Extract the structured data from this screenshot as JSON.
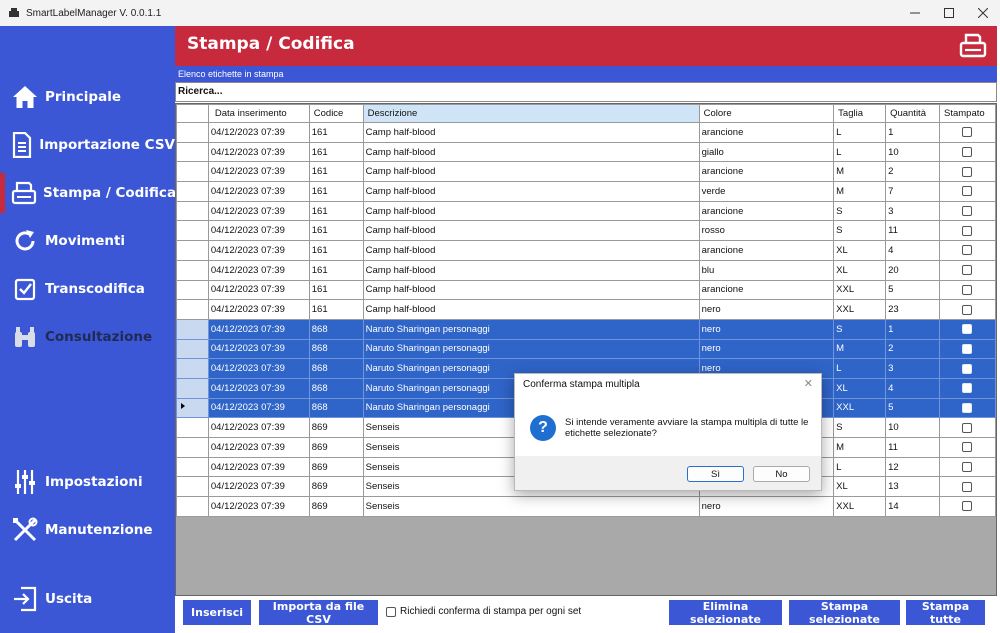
{
  "window": {
    "title": "SmartLabelManager V. 0.0.1.1"
  },
  "sidebar": {
    "items": [
      {
        "label": "Principale",
        "icon": "home-icon",
        "active": false
      },
      {
        "label": "Importazione CSV",
        "icon": "file-icon",
        "active": false
      },
      {
        "label": "Stampa / Codifica",
        "icon": "printer-icon",
        "active": true
      },
      {
        "label": "Movimenti",
        "icon": "refresh-icon",
        "active": false
      },
      {
        "label": "Transcodifica",
        "icon": "checkbox-icon",
        "active": false
      },
      {
        "label": "Consultazione",
        "icon": "binoculars-icon",
        "active": false
      },
      {
        "label": "Impostazioni",
        "icon": "sliders-icon",
        "active": false
      },
      {
        "label": "Manutenzione",
        "icon": "tools-icon",
        "active": false
      },
      {
        "label": "Uscita",
        "icon": "exit-icon",
        "active": false
      }
    ]
  },
  "header": {
    "title": "Stampa / Codifica",
    "print_icon": "printer-icon"
  },
  "subheader": {
    "label": "Elenco etichette in stampa"
  },
  "search": {
    "value": "Ricerca..."
  },
  "grid": {
    "columns": [
      "Data inserimento",
      "Codice",
      "Descrizione",
      "Colore",
      "Taglia",
      "Quantità",
      "Stampato"
    ],
    "rows": [
      {
        "data": "04/12/2023 07:39",
        "codice": "161",
        "descrizione": "Camp half-blood",
        "colore": "arancione",
        "taglia": "L",
        "quantita": "1",
        "stampato": false,
        "selected": false
      },
      {
        "data": "04/12/2023 07:39",
        "codice": "161",
        "descrizione": "Camp half-blood",
        "colore": "giallo",
        "taglia": "L",
        "quantita": "10",
        "stampato": false,
        "selected": false
      },
      {
        "data": "04/12/2023 07:39",
        "codice": "161",
        "descrizione": "Camp half-blood",
        "colore": "arancione",
        "taglia": "M",
        "quantita": "2",
        "stampato": false,
        "selected": false
      },
      {
        "data": "04/12/2023 07:39",
        "codice": "161",
        "descrizione": "Camp half-blood",
        "colore": "verde",
        "taglia": "M",
        "quantita": "7",
        "stampato": false,
        "selected": false
      },
      {
        "data": "04/12/2023 07:39",
        "codice": "161",
        "descrizione": "Camp half-blood",
        "colore": "arancione",
        "taglia": "S",
        "quantita": "3",
        "stampato": false,
        "selected": false
      },
      {
        "data": "04/12/2023 07:39",
        "codice": "161",
        "descrizione": "Camp half-blood",
        "colore": "rosso",
        "taglia": "S",
        "quantita": "11",
        "stampato": false,
        "selected": false
      },
      {
        "data": "04/12/2023 07:39",
        "codice": "161",
        "descrizione": "Camp half-blood",
        "colore": "arancione",
        "taglia": "XL",
        "quantita": "4",
        "stampato": false,
        "selected": false
      },
      {
        "data": "04/12/2023 07:39",
        "codice": "161",
        "descrizione": "Camp half-blood",
        "colore": "blu",
        "taglia": "XL",
        "quantita": "20",
        "stampato": false,
        "selected": false
      },
      {
        "data": "04/12/2023 07:39",
        "codice": "161",
        "descrizione": "Camp half-blood",
        "colore": "arancione",
        "taglia": "XXL",
        "quantita": "5",
        "stampato": false,
        "selected": false
      },
      {
        "data": "04/12/2023 07:39",
        "codice": "161",
        "descrizione": "Camp half-blood",
        "colore": "nero",
        "taglia": "XXL",
        "quantita": "23",
        "stampato": false,
        "selected": false
      },
      {
        "data": "04/12/2023 07:39",
        "codice": "868",
        "descrizione": "Naruto Sharingan personaggi",
        "colore": "nero",
        "taglia": "S",
        "quantita": "1",
        "stampato": false,
        "selected": true
      },
      {
        "data": "04/12/2023 07:39",
        "codice": "868",
        "descrizione": "Naruto Sharingan personaggi",
        "colore": "nero",
        "taglia": "M",
        "quantita": "2",
        "stampato": false,
        "selected": true
      },
      {
        "data": "04/12/2023 07:39",
        "codice": "868",
        "descrizione": "Naruto Sharingan personaggi",
        "colore": "nero",
        "taglia": "L",
        "quantita": "3",
        "stampato": false,
        "selected": true
      },
      {
        "data": "04/12/2023 07:39",
        "codice": "868",
        "descrizione": "Naruto Sharingan personaggi",
        "colore": "",
        "taglia": "XL",
        "quantita": "4",
        "stampato": false,
        "selected": true
      },
      {
        "data": "04/12/2023 07:39",
        "codice": "868",
        "descrizione": "Naruto Sharingan personaggi",
        "colore": "",
        "taglia": "XXL",
        "quantita": "5",
        "stampato": false,
        "selected": true,
        "current": true
      },
      {
        "data": "04/12/2023 07:39",
        "codice": "869",
        "descrizione": "Senseis",
        "colore": "",
        "taglia": "S",
        "quantita": "10",
        "stampato": false,
        "selected": false
      },
      {
        "data": "04/12/2023 07:39",
        "codice": "869",
        "descrizione": "Senseis",
        "colore": "",
        "taglia": "M",
        "quantita": "11",
        "stampato": false,
        "selected": false
      },
      {
        "data": "04/12/2023 07:39",
        "codice": "869",
        "descrizione": "Senseis",
        "colore": "",
        "taglia": "L",
        "quantita": "12",
        "stampato": false,
        "selected": false
      },
      {
        "data": "04/12/2023 07:39",
        "codice": "869",
        "descrizione": "Senseis",
        "colore": "",
        "taglia": "XL",
        "quantita": "13",
        "stampato": false,
        "selected": false
      },
      {
        "data": "04/12/2023 07:39",
        "codice": "869",
        "descrizione": "Senseis",
        "colore": "nero",
        "taglia": "XXL",
        "quantita": "14",
        "stampato": false,
        "selected": false
      }
    ]
  },
  "bottom": {
    "insert_label": "Inserisci",
    "import_label": "Importa da file CSV",
    "confirm_label": "Richiedi conferma di stampa per ogni set",
    "delete_label": "Elimina selezionate",
    "print_selected_label": "Stampa selezionate",
    "print_all_label": "Stampa tutte"
  },
  "dialog": {
    "title": "Conferma stampa multipla",
    "message": "Si intende veramente avviare la stampa multipla di tutte le etichette selezionate?",
    "yes_label": "Sì",
    "no_label": "No",
    "icon": "question-icon"
  },
  "colors": {
    "sidebar": "#3b57d6",
    "header": "#c62a3c",
    "selection": "#2f64c8"
  }
}
